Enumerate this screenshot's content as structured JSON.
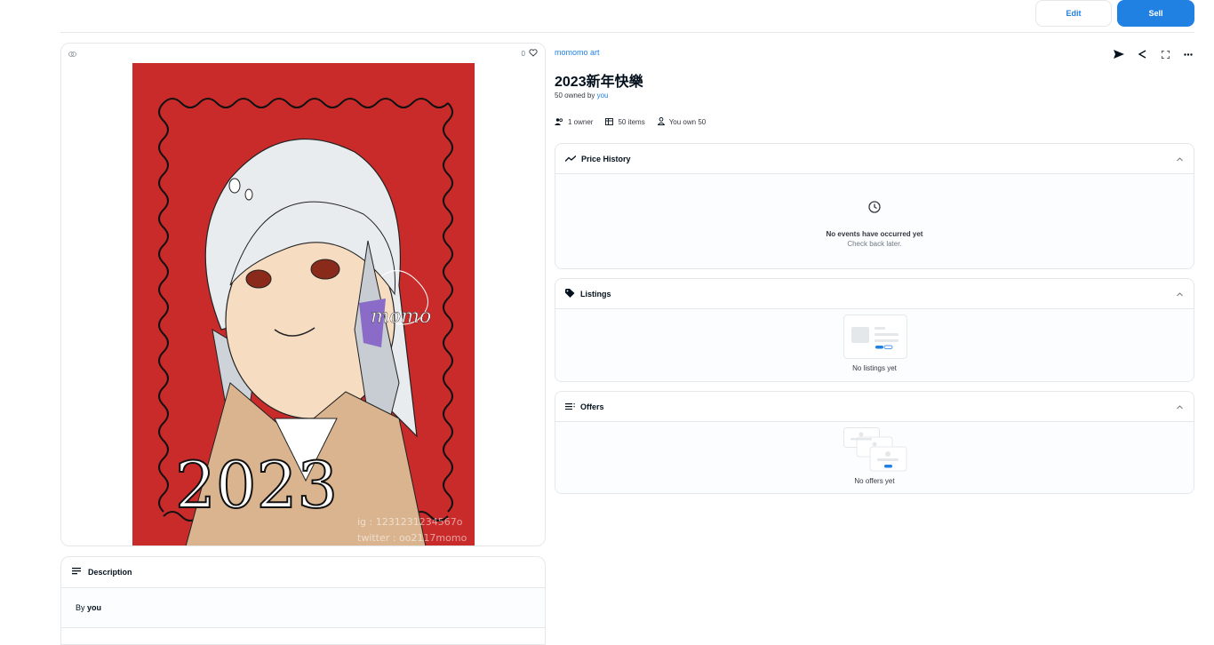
{
  "header": {
    "edit_label": "Edit",
    "sell_label": "Sell"
  },
  "item": {
    "favorites_count": "0",
    "collection": "momomo art",
    "title": "2023新年快樂",
    "owned_prefix": "50 owned by",
    "owned_by": "you",
    "stats": {
      "owners": "1 owner",
      "items": "50 items",
      "you_own": "You own 50"
    }
  },
  "description": {
    "heading": "Description",
    "by_prefix": "By",
    "by_name": "you"
  },
  "price_history": {
    "heading": "Price History",
    "empty_title": "No events have occurred yet",
    "empty_sub": "Check back later."
  },
  "listings": {
    "heading": "Listings",
    "empty": "No listings yet"
  },
  "offers": {
    "heading": "Offers",
    "empty": "No offers yet"
  },
  "artwork": {
    "year_text": "2023",
    "signature": "momo",
    "credit_lines": [
      "ig : 1231231234567o",
      "twitter : oo2117momo"
    ]
  },
  "colors": {
    "accent": "#2081e2",
    "art_background": "#c92b2b",
    "border": "#e5e8eb"
  },
  "icons": [
    "chain-icon",
    "heart-icon",
    "send-icon",
    "share-icon",
    "fullscreen-icon",
    "more-icon",
    "owners-icon",
    "grid-icon",
    "person-icon",
    "trend-icon",
    "tag-icon",
    "list-icon",
    "clock-icon",
    "chevron-up-icon",
    "description-icon"
  ]
}
